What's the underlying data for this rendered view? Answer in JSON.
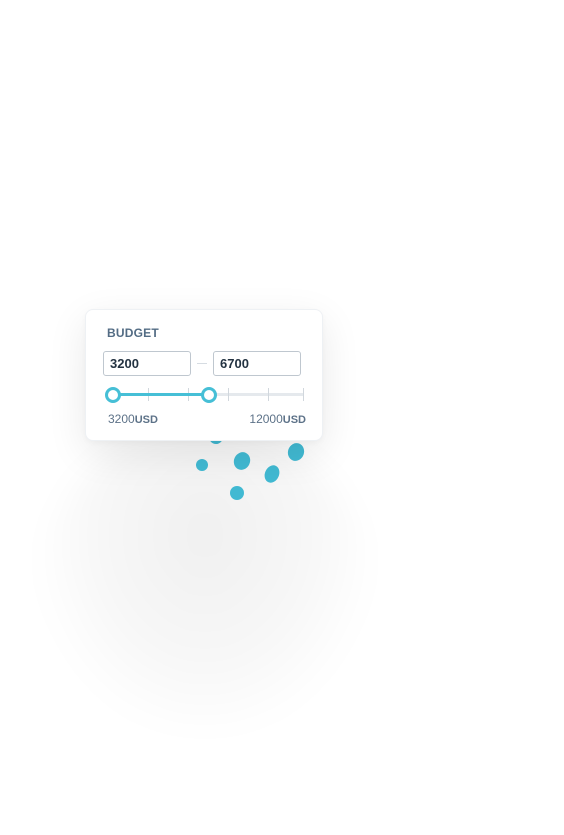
{
  "budget_widget": {
    "title": "BUDGET",
    "min_value": "3200",
    "max_value": "6700",
    "slider": {
      "min": 3200,
      "max": 12000,
      "lower_value": 3200,
      "upper_value": 6700,
      "tick_count": 5
    },
    "range_min_label": "3200",
    "range_max_label": "12000",
    "currency": "USD"
  },
  "colors": {
    "accent": "#46bfd6",
    "dots": "#41b9d2",
    "title_text": "#536c84",
    "field_text": "#233241"
  }
}
